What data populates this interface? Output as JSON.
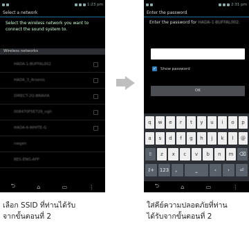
{
  "left_phone": {
    "status": {
      "time": "1:23 pm"
    },
    "title": "Select a network",
    "description": "Select the wireless network you want to connect the sound system to.",
    "section_header": "Wireless networks",
    "networks": [
      "HADA-1-BUFFAL002",
      "HADA_3_Arsenis",
      "DIRECT-2Q-BRAVIA",
      "008470F5E729_ngh",
      "HADA-6-WHITE-G",
      "nwgen",
      "BES-ENG-AFP"
    ],
    "nav": {
      "back": "⮌",
      "home": "⌂",
      "recent": "▭",
      "menu": "⋮"
    }
  },
  "right_phone": {
    "status": {
      "time": "2:31 pm"
    },
    "title": "Enter the password",
    "description_prefix": "Enter the password for",
    "description_ssid": "HADA-1-BUFFAL002.",
    "password_value": "",
    "show_password_label": "Show password",
    "show_password_checked": "✓",
    "ok_label": "OK",
    "keyboard_rows": [
      [
        "q",
        "w",
        "e",
        "r",
        "t",
        "y",
        "u",
        "i",
        "o",
        "p"
      ],
      [
        "a",
        "s",
        "d",
        "f",
        "g",
        "h",
        "j",
        "k",
        "l",
        "@"
      ],
      [
        "⇧",
        "z",
        "x",
        "c",
        "v",
        "b",
        "n",
        "m",
        "⌫"
      ],
      [
        "ﾇ+",
        "123",
        "，",
        "⎵",
        "‹",
        "›",
        "⏎"
      ]
    ],
    "nav": {
      "back": "⮌",
      "home": "⌂",
      "recent": "▭",
      "menu": "⋮"
    }
  },
  "captions": {
    "left_line1": "เลือก SSID ที่ท่านได้รับ",
    "left_line2": "จากขั้นตอนที่ 2",
    "right_line1": "ใส่คีย์ความปลอดภัยที่ท่าน",
    "right_line2": "ได้รับจากขั้นตอนที่ 2"
  }
}
